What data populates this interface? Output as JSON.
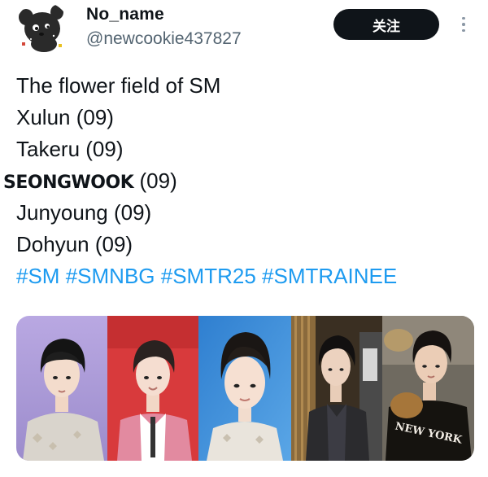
{
  "user": {
    "display_name": "No_name",
    "handle": "@newcookie437827",
    "avatar_icon": "cartoon-bear-avatar-icon"
  },
  "follow_button": {
    "label": "关注"
  },
  "more_icon": "more-vertical-icon",
  "tweet": {
    "lines": [
      "The flower field of SM",
      "Xulun (09)",
      "Takeru (09)"
    ],
    "styled_name": "SEONGWOOK",
    "styled_suffix": " (09)",
    "lines_after": [
      "Junyoung (09)",
      "Dohyun (09)"
    ],
    "hashtags": [
      "#SM",
      "#SMNBG",
      "#SMTR25",
      "#SMTRAINEE"
    ]
  },
  "media": {
    "shirt_text": "NEW YORK",
    "colors": {
      "tile1_bg": "#b2a0dc",
      "tile2_bg": "#d8383a",
      "tile3_bg": "#3f8fd6",
      "tile4_bg": "#3a2f22",
      "tile5_bg": "#6f6a60"
    }
  },
  "colors": {
    "accent": "#1d9bf0",
    "text": "#0f1419",
    "muted": "#536471",
    "button_bg": "#0f1419"
  }
}
